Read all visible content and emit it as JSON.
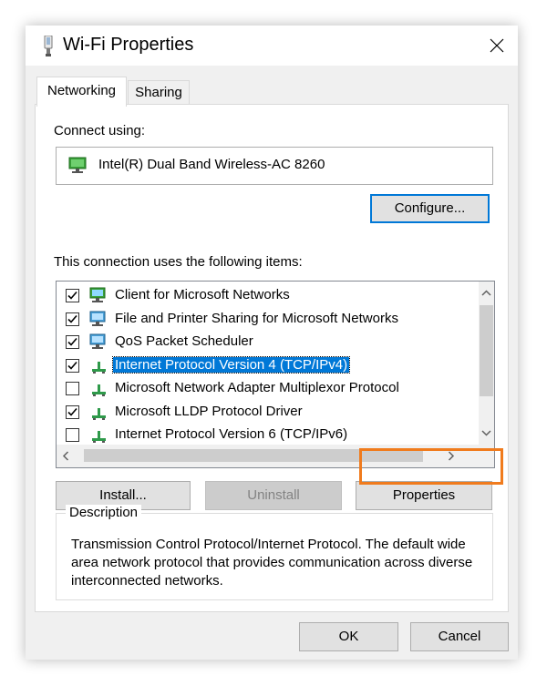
{
  "window": {
    "title": "Wi-Fi Properties",
    "icons": {
      "title": "wifi-adapter-icon",
      "close": "close-icon"
    }
  },
  "tabs": [
    {
      "label": "Networking",
      "active": true
    },
    {
      "label": "Sharing",
      "active": false
    }
  ],
  "networking": {
    "connect_using_label": "Connect using:",
    "adapter_name": "Intel(R) Dual Band Wireless-AC 8260",
    "configure_label": "Configure...",
    "items_label": "This connection uses the following items:",
    "items": [
      {
        "label": "Client for Microsoft Networks",
        "checked": true,
        "icon": "network-client-icon"
      },
      {
        "label": "File and Printer Sharing for Microsoft Networks",
        "checked": true,
        "icon": "network-service-icon"
      },
      {
        "label": "QoS Packet Scheduler",
        "checked": true,
        "icon": "network-service-icon"
      },
      {
        "label": "Internet Protocol Version 4 (TCP/IPv4)",
        "checked": true,
        "selected": true,
        "icon": "protocol-icon"
      },
      {
        "label": "Microsoft Network Adapter Multiplexor Protocol",
        "checked": false,
        "icon": "protocol-icon"
      },
      {
        "label": "Microsoft LLDP Protocol Driver",
        "checked": true,
        "icon": "protocol-icon"
      },
      {
        "label": "Internet Protocol Version 6 (TCP/IPv6)",
        "checked": false,
        "icon": "protocol-icon"
      }
    ],
    "buttons": {
      "install": "Install...",
      "uninstall": "Uninstall",
      "properties": "Properties"
    },
    "description_title": "Description",
    "description_text": "Transmission Control Protocol/Internet Protocol. The default wide area network protocol that provides communication across diverse interconnected networks."
  },
  "footer": {
    "ok_label": "OK",
    "cancel_label": "Cancel"
  },
  "colors": {
    "selection": "#0078d7",
    "highlight_outline": "#f07b1d",
    "dialog_bg": "#f0f0f0"
  }
}
